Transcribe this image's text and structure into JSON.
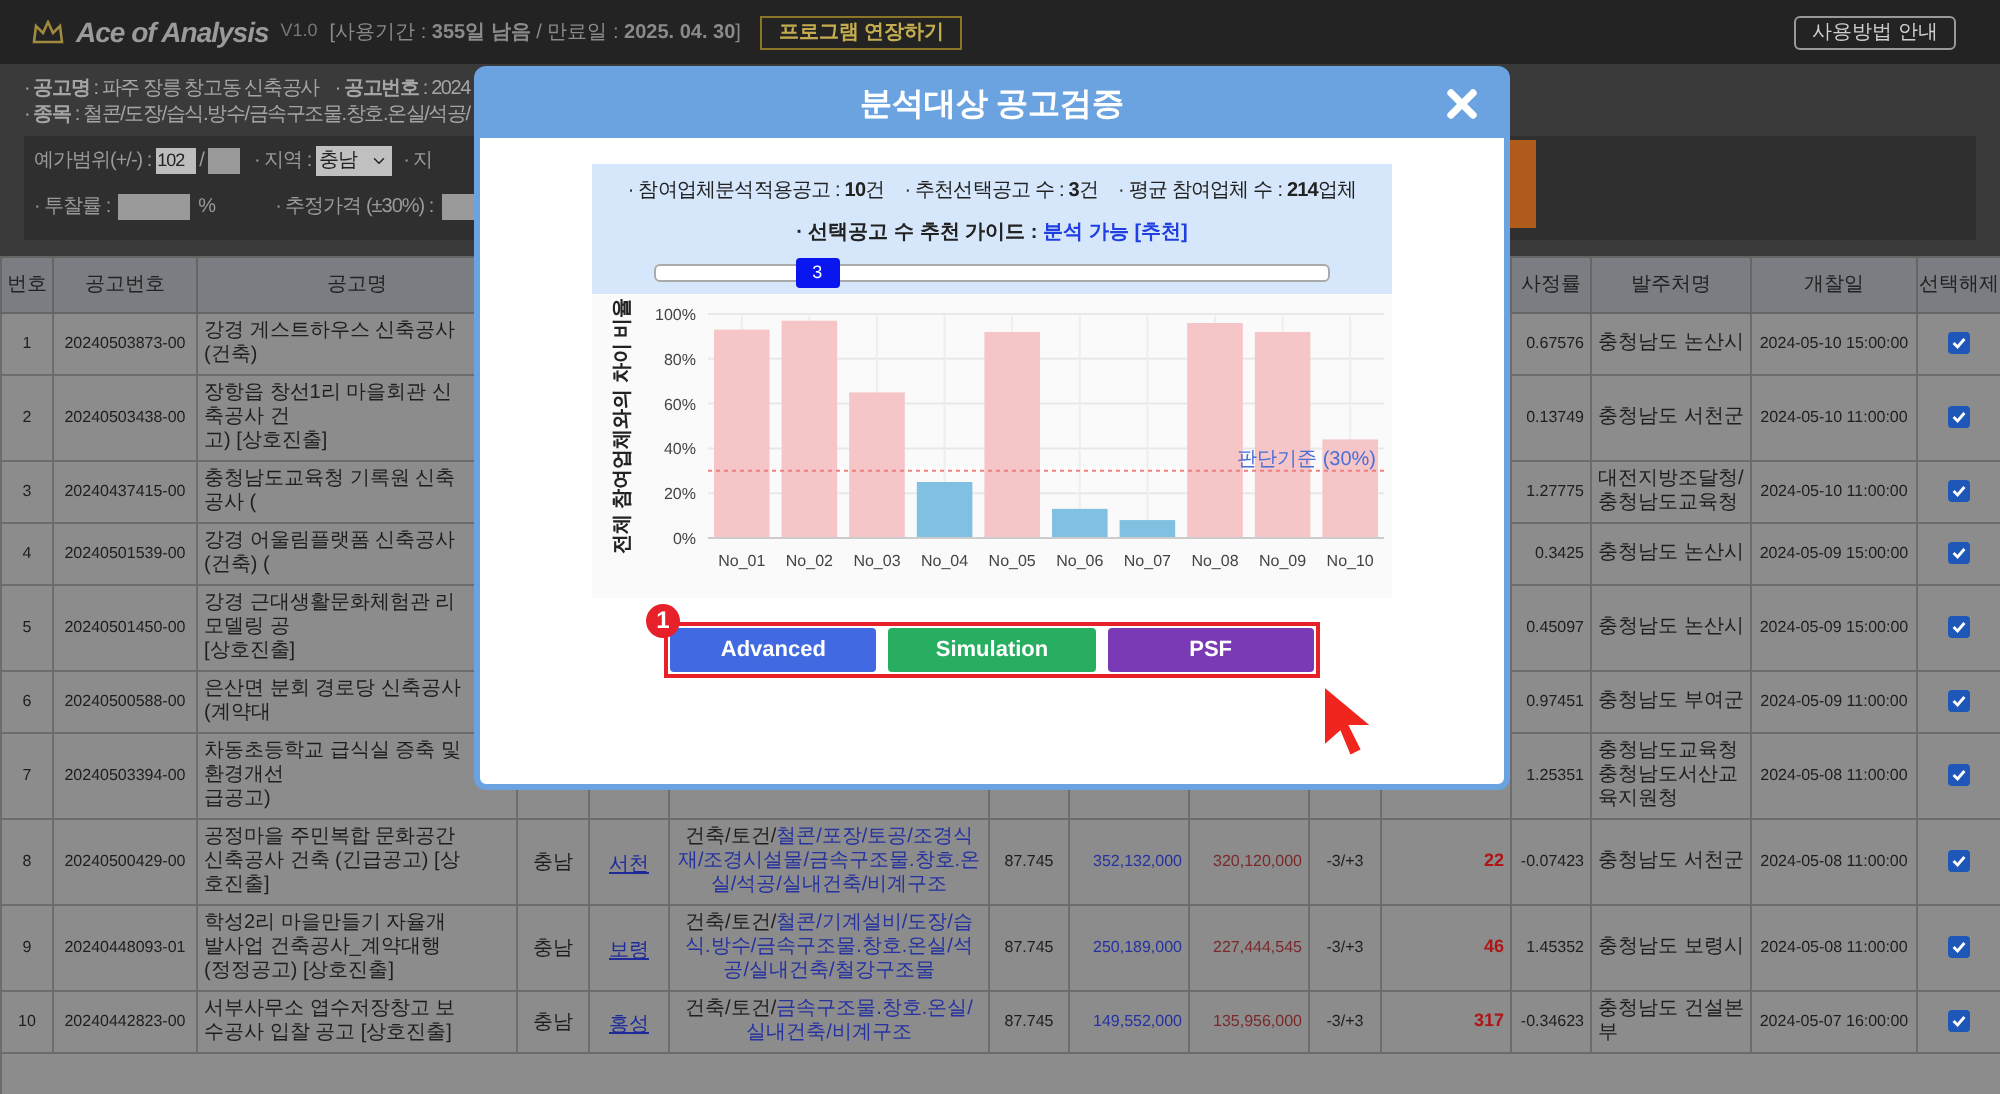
{
  "app": {
    "logo": "Ace of Analysis",
    "version": "V1.0",
    "license": "[사용기간 : **355일 남음** / 만료일 : **2025. 04. 30**]",
    "extend_button": "프로그램 연장하기",
    "help_button": "사용방법 안내"
  },
  "notice": {
    "title": "· **공고명** : 파주 장릉 창고동 신축공사",
    "number": "· **공고번호** : 2024",
    "categories": "· **종목** : 철콘/도장/습식.방수/금속구조물.창호.온실/석공/"
  },
  "filters": {
    "range_label": "예가범위(+/-) :",
    "range_low": "102",
    "range_sep": "/",
    "region_label": "· 지역 :",
    "region_value": "충남",
    "region2_label": "· 지",
    "rate_label": "· 투찰률 :",
    "rate_unit": "%",
    "estimate_label": "· 추정가격 (±30%) :"
  },
  "table": {
    "headers": {
      "no": "번호",
      "id": "공고번호",
      "name": "공고명",
      "ratio": "사정률",
      "agency": "발주처명",
      "date": "개찰일",
      "deselect": "선택해제"
    },
    "rows": [
      {
        "no": "1",
        "id": "20240503873-00",
        "name_lines": [
          "강경 게스트하우스 신축공사(건축)"
        ],
        "ratio": "0.67576",
        "agency": "충청남도 논산시",
        "date": "2024-05-10 15:00:00",
        "checked": true
      },
      {
        "no": "2",
        "id": "20240503438-00",
        "name_lines": [
          "장항읍 창선1리 마을회관 신축공사 건",
          "고) [상호진출]"
        ],
        "ratio": "0.13749",
        "agency": "충청남도 서천군",
        "date": "2024-05-10 11:00:00",
        "checked": true
      },
      {
        "no": "3",
        "id": "20240437415-00",
        "name_lines": [
          "충청남도교육청 기록원 신축공사 ("
        ],
        "ratio": "1.27775",
        "agency": "대전지방조달청/충청남도교육청",
        "date": "2024-05-10 11:00:00",
        "checked": true
      },
      {
        "no": "4",
        "id": "20240501539-00",
        "name_lines": [
          "강경 어울림플랫폼 신축공사(건축) ("
        ],
        "ratio": "0.3425",
        "agency": "충청남도 논산시",
        "date": "2024-05-09 15:00:00",
        "checked": true
      },
      {
        "no": "5",
        "id": "20240501450-00",
        "name_lines": [
          "강경 근대생활문화체험관 리모델링 공",
          "[상호진출]"
        ],
        "ratio": "0.45097",
        "agency": "충청남도 논산시",
        "date": "2024-05-09 15:00:00",
        "checked": true
      },
      {
        "no": "6",
        "id": "20240500588-00",
        "name_lines": [
          "은산면 분회 경로당 신축공사(계약대"
        ],
        "ratio": "0.97451",
        "agency": "충청남도 부여군",
        "date": "2024-05-09 11:00:00",
        "checked": true
      },
      {
        "no": "7",
        "id": "20240503394-00",
        "name_lines": [
          "차동초등학교 급식실 증축 및 환경개선",
          "급공고)"
        ],
        "ratio": "1.25351",
        "agency": "충청남도교육청 충청남도서산교육지원청",
        "date": "2024-05-08 11:00:00",
        "checked": true
      },
      {
        "no": "8",
        "id": "20240500429-00",
        "name_lines": [
          "공정마을 주민복합 문화공간 신축공사 건축 (긴급공고) [상호진출]"
        ],
        "region": "충남",
        "city": "서천",
        "cat_prefix": "건축/토건/",
        "cat_rest": "철콘/포장/토공/조경식재/조경시설물/금속구조물.창호.온실/석공/실내건축/비계구조",
        "rate": "87.745",
        "base": "352,132,000",
        "estimate": "320,120,000",
        "range": "-3/+3",
        "count": "22",
        "ratio": "-0.07423",
        "agency": "충청남도 서천군",
        "date": "2024-05-08 11:00:00",
        "checked": true
      },
      {
        "no": "9",
        "id": "20240448093-01",
        "name_lines": [
          "학성2리 마을만들기 자율개발사업 건축공사_계약대행 (정정공고) [상호진출]"
        ],
        "region": "충남",
        "city": "보령",
        "cat_prefix": "건축/토건/",
        "cat_rest": "철콘/기계설비/도장/습식.방수/금속구조물.창호.온실/석공/실내건축/철강구조물",
        "rate": "87.745",
        "base": "250,189,000",
        "estimate": "227,444,545",
        "range": "-3/+3",
        "count": "46",
        "ratio": "1.45352",
        "agency": "충청남도 보령시",
        "date": "2024-05-08 11:00:00",
        "checked": true
      },
      {
        "no": "10",
        "id": "20240442823-00",
        "name_lines": [
          "서부사무소 엽수저장창고 보수공사 입찰 공고 [상호진출]"
        ],
        "region": "충남",
        "city": "홍성",
        "cat_prefix": "건축/토건/",
        "cat_rest": "금속구조물.창호.온실/실내건축/비계구조",
        "rate": "87.745",
        "base": "149,552,000",
        "estimate": "135,956,000",
        "range": "-3/+3",
        "count": "317",
        "ratio": "-0.34623",
        "agency": "충청남도 건설본부",
        "date": "2024-05-07 16:00:00",
        "checked": true
      }
    ]
  },
  "modal": {
    "title": "분석대상 공고검증",
    "stats": [
      "· 참여업체분석적용공고 : **10**건",
      "· 추천선택공고 수 : **3**건",
      "· 평균 참여업체 수 : **214**업체"
    ],
    "guide_label": "· 선택공고 수 추천 가이드 : ",
    "guide_value": "분석 가능 [추천]",
    "slider": {
      "value": "3",
      "level": 0.24
    },
    "chart_data": {
      "type": "bar",
      "ylabel": "전체 참여업체와의 차이 비율",
      "categories": [
        "No_01",
        "No_02",
        "No_03",
        "No_04",
        "No_05",
        "No_06",
        "No_07",
        "No_08",
        "No_09",
        "No_10"
      ],
      "series": [
        {
          "color": "#f5c5c8",
          "values": [
            93,
            97,
            65,
            null,
            92,
            null,
            null,
            96,
            92,
            44
          ]
        },
        {
          "color": "#80c0e0",
          "values": [
            null,
            null,
            null,
            25,
            null,
            13,
            8,
            null,
            null,
            null
          ]
        }
      ],
      "grid": true,
      "ylim": [
        0,
        100
      ],
      "yticks": [
        {
          "value": 0,
          "label": "0%"
        },
        {
          "value": 20,
          "label": "20%"
        },
        {
          "value": 40,
          "label": "40%"
        },
        {
          "value": 60,
          "label": "60%"
        },
        {
          "value": 80,
          "label": "80%"
        },
        {
          "value": 100,
          "label": "100%"
        }
      ],
      "ref_lines": [
        {
          "axis": "y",
          "value": 30,
          "label": "판단기준 (30%)",
          "color": "#f08080"
        }
      ]
    },
    "badge": "1",
    "actions": [
      {
        "label": "Advanced",
        "color": "#4169e1"
      },
      {
        "label": "Simulation",
        "color": "#27ae60"
      },
      {
        "label": "PSF",
        "color": "#7b3ab5"
      }
    ]
  }
}
